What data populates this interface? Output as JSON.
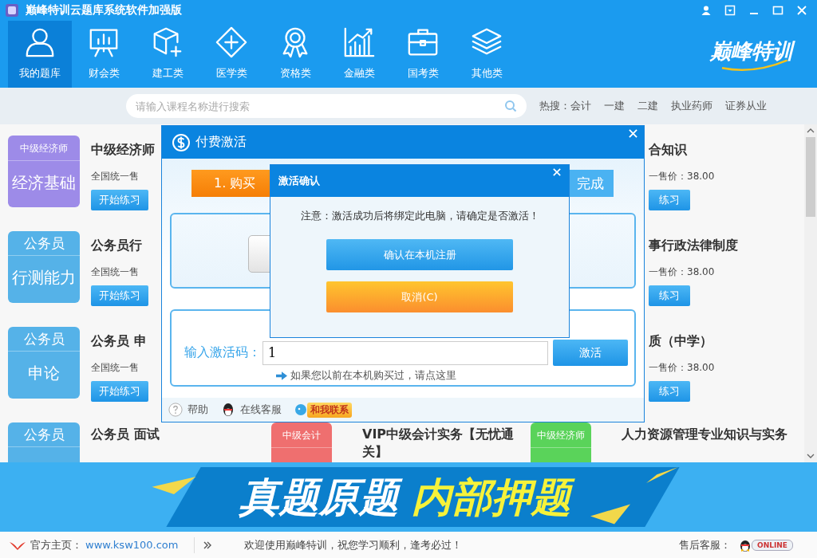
{
  "window": {
    "title": "巅峰特训云题库系统软件加强版"
  },
  "nav": {
    "items": [
      {
        "label": "我的题库",
        "kind": "person",
        "selected": true
      },
      {
        "label": "财会类",
        "kind": "board",
        "selected": false
      },
      {
        "label": "建工类",
        "kind": "cube",
        "selected": false
      },
      {
        "label": "医学类",
        "kind": "cross",
        "selected": false
      },
      {
        "label": "资格类",
        "kind": "medal",
        "selected": false
      },
      {
        "label": "金融类",
        "kind": "chart",
        "selected": false
      },
      {
        "label": "国考类",
        "kind": "case",
        "selected": false
      },
      {
        "label": "其他类",
        "kind": "layers",
        "selected": false
      }
    ],
    "logo": "巅峰特训"
  },
  "search": {
    "placeholder": "请输入课程名称进行搜索",
    "hot_label": "热搜：",
    "hot_terms": [
      "会计",
      "一建",
      "二建",
      "执业药师",
      "证券从业"
    ]
  },
  "courses": {
    "rows": [
      {
        "left": {
          "badge_top": "中级经济师",
          "badge_main": "经济基础",
          "color": "#9d8be8",
          "title": "中级经济师",
          "price": "全国统一售",
          "button": "开始练习"
        },
        "right": {
          "title": "合知识",
          "price": "一售价：38.00",
          "button": "练习"
        }
      },
      {
        "left": {
          "badge_top": "公务员",
          "badge_main": "行测能力",
          "color": "#55b2e8",
          "title": "公务员行",
          "price": "全国统一售",
          "button": "开始练习"
        },
        "right": {
          "title": "事行政法律制度",
          "price": "一售价：38.00",
          "button": "练习"
        }
      },
      {
        "left": {
          "badge_top": "公务员",
          "badge_main": "申论",
          "color": "#55b2e8",
          "title": "公务员 申",
          "price": "全国统一售",
          "button": "开始练习"
        },
        "right": {
          "title": "质（中学）",
          "price": "一售价：38.00",
          "button": "练习"
        }
      }
    ],
    "last_row": [
      {
        "badge_top": "公务员",
        "color": "#55b2e8",
        "title": "公务员 面试"
      },
      {
        "badge_top": "中级会计",
        "color": "#ef6f6f",
        "title": "VIP中级会计实务【无忧通关】"
      },
      {
        "badge_top": "中级经济师",
        "color": "#5ad35a",
        "title": "人力资源管理专业知识与实务"
      }
    ]
  },
  "banner": {
    "white_text": "真题原题",
    "yellow_text": "内部押题"
  },
  "footer": {
    "home_label": "官方主页：",
    "home_link": "www.ksw100.com",
    "welcome": "欢迎使用巅峰特训，祝您学习顺利，逢考必过！",
    "service_label": "售后客服：",
    "online_badge": "ONLINE"
  },
  "pay_dialog": {
    "title": "付费激活",
    "steps": [
      {
        "label": "1. 购买",
        "selected": true
      },
      {
        "label": "完成",
        "selected": false
      }
    ],
    "code_label": "输入激活码：",
    "code_value": "1",
    "activate_button": "激活",
    "hint_link": "如果您以前在本机购买过，请点这里",
    "footer_links": [
      {
        "label": "帮助",
        "kind": "help"
      },
      {
        "label": "在线客服",
        "kind": "qq"
      },
      {
        "label": "和我联系",
        "kind": "contact"
      }
    ]
  },
  "confirm_dialog": {
    "title": "激活确认",
    "message": "注意：激活成功后将绑定此电脑，请确定是否激活！",
    "confirm_button": "确认在本机注册",
    "cancel_button": "取消(C)"
  }
}
